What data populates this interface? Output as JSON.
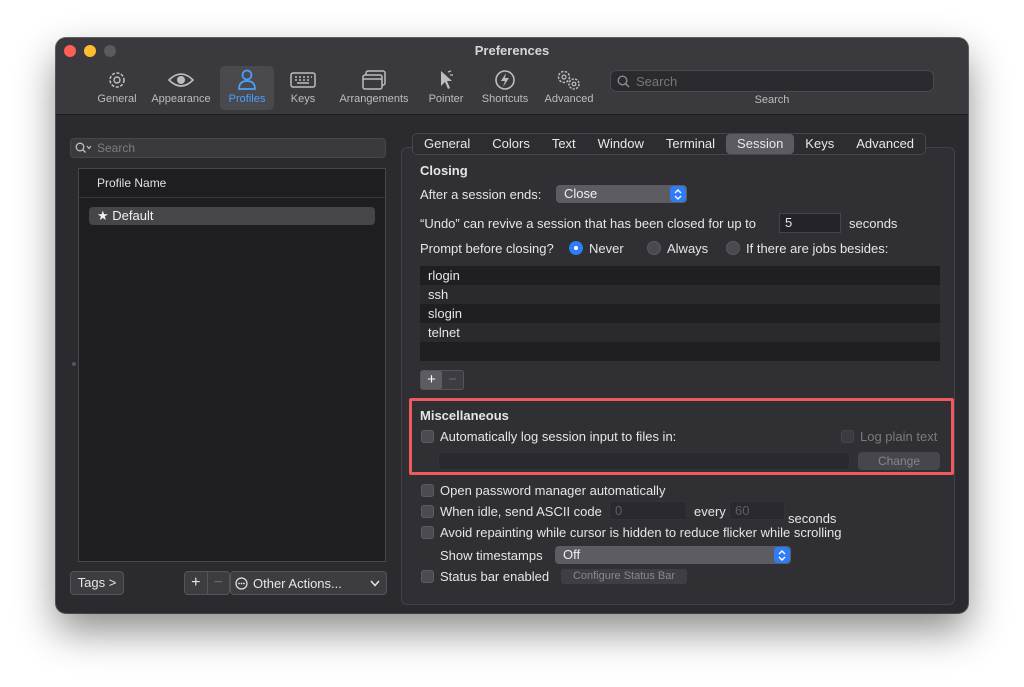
{
  "window": {
    "title": "Preferences"
  },
  "toolbar": {
    "items": [
      {
        "label": "General",
        "icon": "gear-icon"
      },
      {
        "label": "Appearance",
        "icon": "eye-icon"
      },
      {
        "label": "Profiles",
        "icon": "person-icon",
        "active": true
      },
      {
        "label": "Keys",
        "icon": "keyboard-icon"
      },
      {
        "label": "Arrangements",
        "icon": "windows-icon"
      },
      {
        "label": "Pointer",
        "icon": "pointer-icon"
      },
      {
        "label": "Shortcuts",
        "icon": "lightning-icon"
      },
      {
        "label": "Advanced",
        "icon": "gears-icon"
      }
    ],
    "search_placeholder": "Search",
    "search_label": "Search"
  },
  "profiles": {
    "filter_placeholder": "Search",
    "header": "Profile Name",
    "items": [
      {
        "name": "Default",
        "default": true
      }
    ],
    "tags_label": "Tags >",
    "add_label": "+",
    "remove_label": "−",
    "other_actions_label": "Other Actions..."
  },
  "tabs": [
    {
      "label": "General"
    },
    {
      "label": "Colors"
    },
    {
      "label": "Text"
    },
    {
      "label": "Window"
    },
    {
      "label": "Terminal"
    },
    {
      "label": "Session",
      "active": true
    },
    {
      "label": "Keys"
    },
    {
      "label": "Advanced"
    }
  ],
  "closing": {
    "heading": "Closing",
    "after_ends_label": "After a session ends:",
    "after_ends_value": "Close",
    "undo_label": "“Undo” can revive a session that has been closed for up to",
    "undo_value": "5",
    "undo_unit": "seconds",
    "prompt_label": "Prompt before closing?",
    "prompt_options": [
      {
        "label": "Never",
        "selected": true
      },
      {
        "label": "Always",
        "selected": false
      },
      {
        "label": "If there are jobs besides:",
        "selected": false
      }
    ],
    "jobs": [
      "rlogin",
      "ssh",
      "slogin",
      "telnet"
    ],
    "jobs_add": "+",
    "jobs_remove": "−"
  },
  "misc": {
    "heading": "Miscellaneous",
    "auto_log_label": "Automatically log session input to files in:",
    "log_plain_label": "Log plain text",
    "change_label": "Change",
    "password_manager_label": "Open password manager automatically",
    "idle_label": "When idle, send ASCII code",
    "idle_code": "0",
    "idle_every": "every",
    "idle_seconds_value": "60",
    "idle_seconds_unit": "seconds",
    "avoid_repaint_label": "Avoid repainting while cursor is hidden to reduce flicker while scrolling",
    "timestamps_label": "Show timestamps",
    "timestamps_value": "Off",
    "status_bar_label": "Status bar enabled",
    "configure_status_bar_label": "Configure Status Bar"
  },
  "colors": {
    "accent": "#2f7df6",
    "highlight_box": "#ef5a5e",
    "active_toolbar": "#4aa0ff"
  }
}
